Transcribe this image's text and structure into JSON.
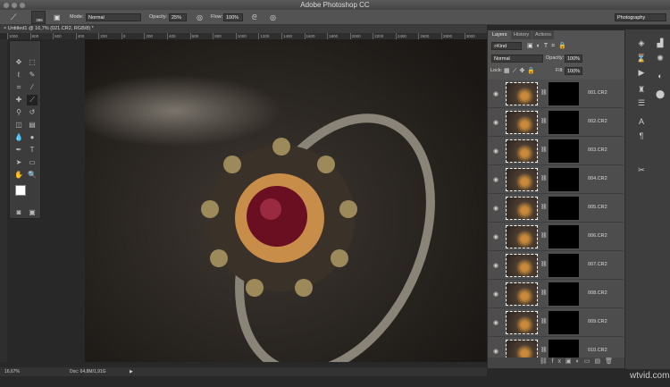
{
  "app_title": "Adobe Photoshop CC",
  "options": {
    "brush_size": "396",
    "mode_label": "Mode:",
    "mode": "Normal",
    "opacity_label": "Opacity:",
    "opacity": "25%",
    "flow_label": "Flow:",
    "flow": "100%",
    "workspace": "Photography"
  },
  "document_tab": "Untitled1 @ 16,7% (021.CR2, RGB/8) *",
  "ruler": [
    "1000",
    "800",
    "600",
    "400",
    "200",
    "0",
    "200",
    "400",
    "600",
    "800",
    "1000",
    "1200",
    "1400",
    "1600",
    "1800",
    "2000",
    "2200",
    "2400",
    "2600",
    "2800",
    "3000"
  ],
  "status": {
    "zoom": "16,67%",
    "doc": "Doc: 64,8M/1,91G"
  },
  "panel": {
    "tabs": [
      "Layers",
      "History",
      "Actions"
    ],
    "kind": "Kind",
    "blend": "Normal",
    "opacity_label": "Opacity:",
    "opacity": "100%",
    "lock_label": "Lock:",
    "fill_label": "Fill:",
    "fill": "100%"
  },
  "layers": [
    "001.CR2",
    "002.CR2",
    "003.CR2",
    "004.CR2",
    "005.CR2",
    "006.CR2",
    "007.CR2",
    "008.CR2",
    "009.CR2",
    "010.CR2"
  ],
  "watermark": "wtvid.com"
}
